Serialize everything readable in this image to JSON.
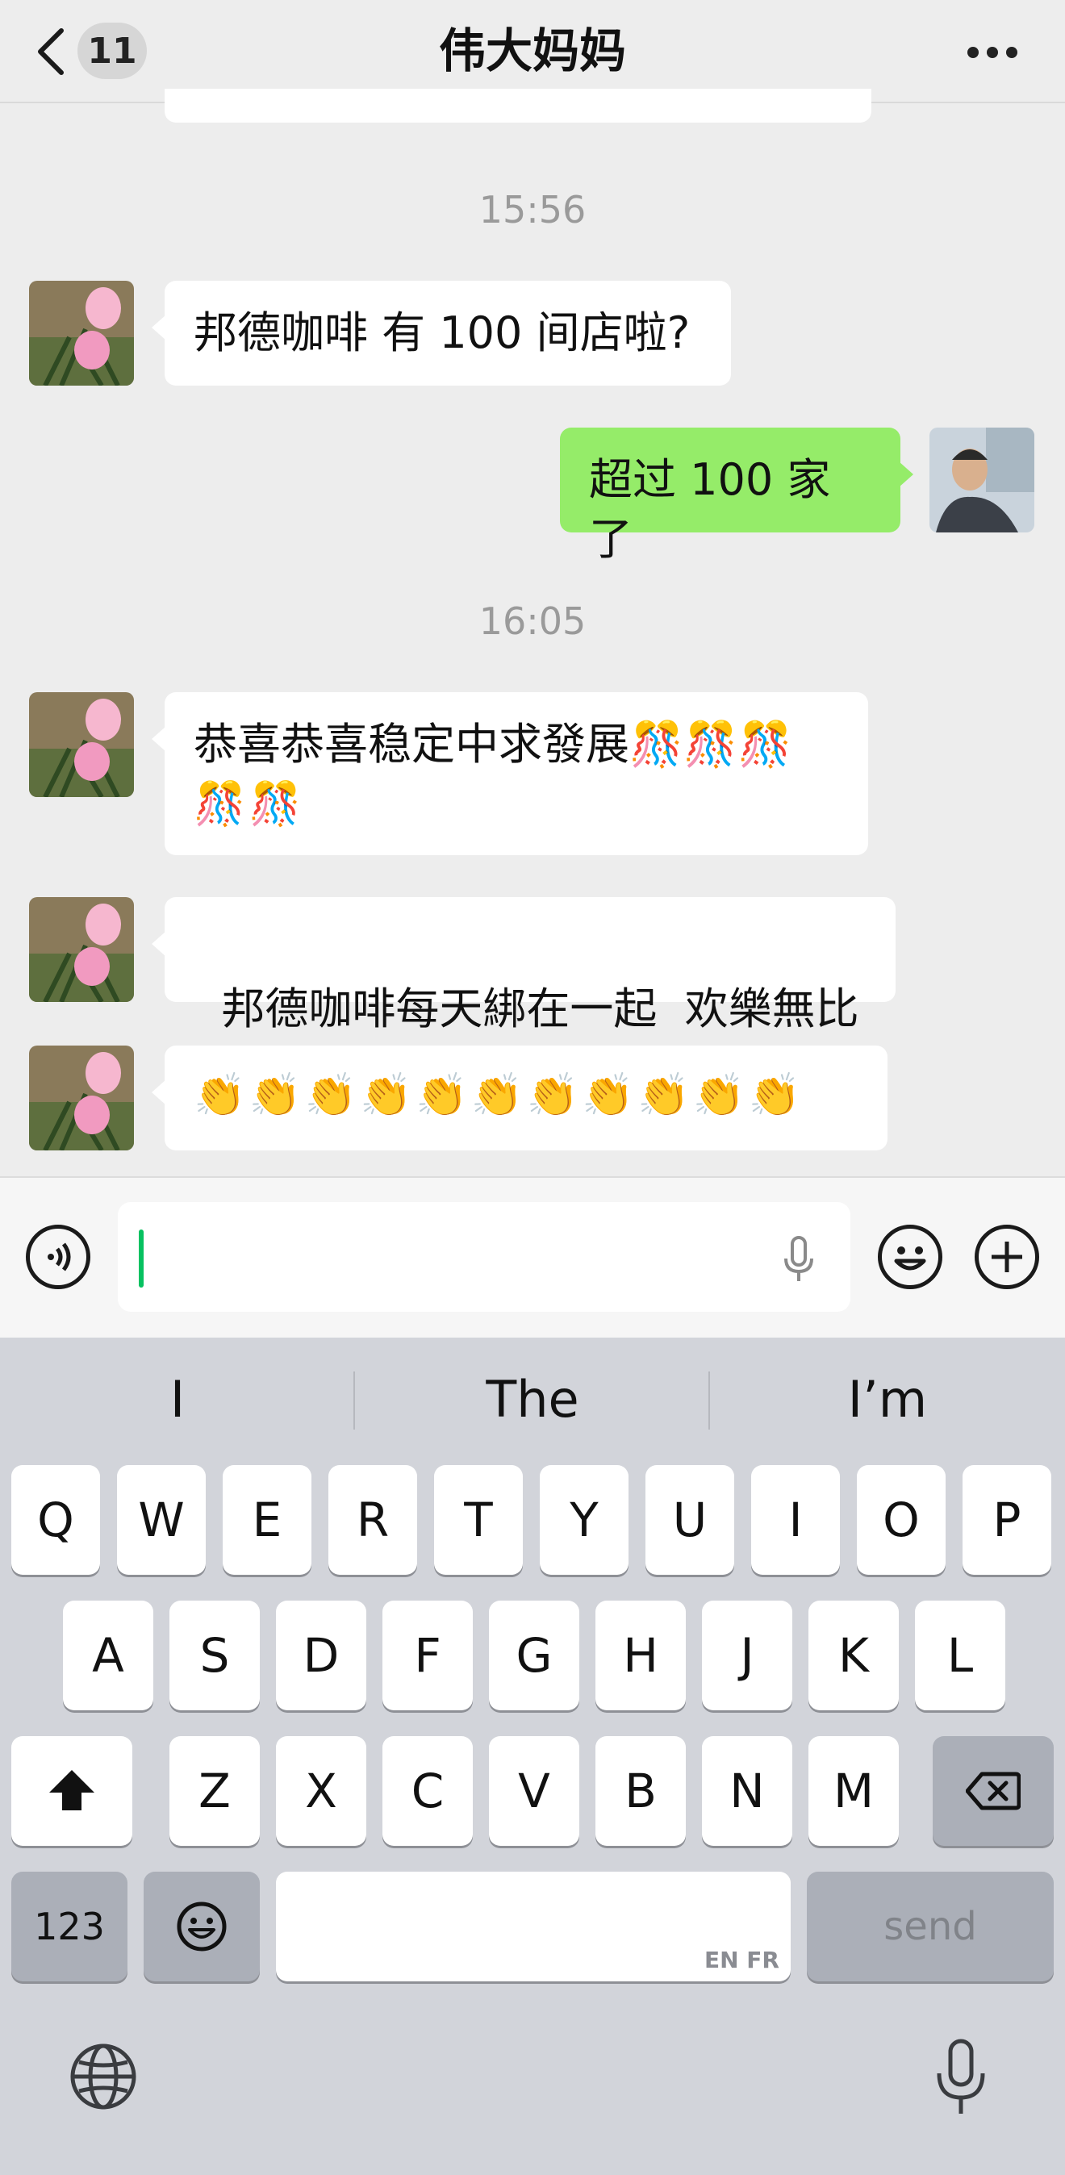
{
  "header": {
    "unread_count": "11",
    "title": "伟大妈妈"
  },
  "messages": [
    {
      "type": "time",
      "text": "15:56"
    },
    {
      "type": "received",
      "text": "邦德咖啡 有 100 间店啦?"
    },
    {
      "type": "sent",
      "text": "超过 100 家了"
    },
    {
      "type": "time",
      "text": "16:05"
    },
    {
      "type": "received",
      "line1": "恭喜恭喜稳定中求發展🎊🎊🎊",
      "line2": "🎊🎊"
    },
    {
      "type": "received",
      "text": "邦德咖啡每天綁在一起  欢樂無比"
    },
    {
      "type": "received",
      "text": "👏👏👏👏👏👏👏👏👏👏👏"
    }
  ],
  "keyboard": {
    "suggestions": [
      "I",
      "The",
      "I’m"
    ],
    "row1": [
      "Q",
      "W",
      "E",
      "R",
      "T",
      "Y",
      "U",
      "I",
      "O",
      "P"
    ],
    "row2": [
      "A",
      "S",
      "D",
      "F",
      "G",
      "H",
      "J",
      "K",
      "L"
    ],
    "row3": [
      "Z",
      "X",
      "C",
      "V",
      "B",
      "N",
      "M"
    ],
    "numbers_label": "123",
    "language_hint": "EN FR",
    "send_label": "send"
  }
}
